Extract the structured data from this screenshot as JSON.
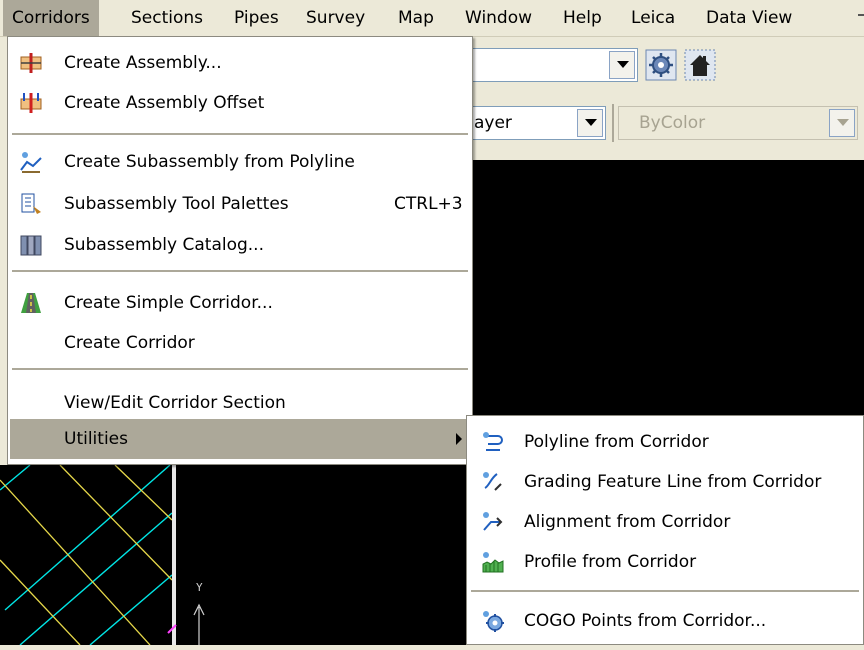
{
  "menubar": {
    "items": [
      "Corridors",
      "Sections",
      "Pipes",
      "Survey",
      "Map",
      "Window",
      "Help",
      "Leica",
      "Data View"
    ]
  },
  "toolbar": {
    "layer_combo_value": "ayer",
    "color_combo_value": "ByColor"
  },
  "corridors_menu": {
    "create_assembly": "Create Assembly...",
    "create_assembly_offset": "Create Assembly Offset",
    "create_subassembly_from_polyline": "Create Subassembly from Polyline",
    "subassembly_tool_palettes": "Subassembly Tool Palettes",
    "subassembly_tool_palettes_shortcut": "CTRL+3",
    "subassembly_catalog": "Subassembly Catalog...",
    "create_simple_corridor": "Create Simple Corridor...",
    "create_corridor": "Create Corridor",
    "view_edit_corridor_section": "View/Edit Corridor Section",
    "utilities": "Utilities"
  },
  "utilities_submenu": {
    "polyline_from_corridor": "Polyline from Corridor",
    "grading_feature_line_from_corridor": "Grading Feature Line from Corridor",
    "alignment_from_corridor": "Alignment from Corridor",
    "profile_from_corridor": "Profile from Corridor",
    "cogo_points_from_corridor": "COGO Points from Corridor..."
  },
  "canvas": {
    "axis_label": "Y"
  },
  "colors": {
    "menu_highlight": "#aca899",
    "canvas_background": "#000000",
    "grid_cyan": "#00e5e5",
    "grid_yellow": "#e6d84a"
  }
}
